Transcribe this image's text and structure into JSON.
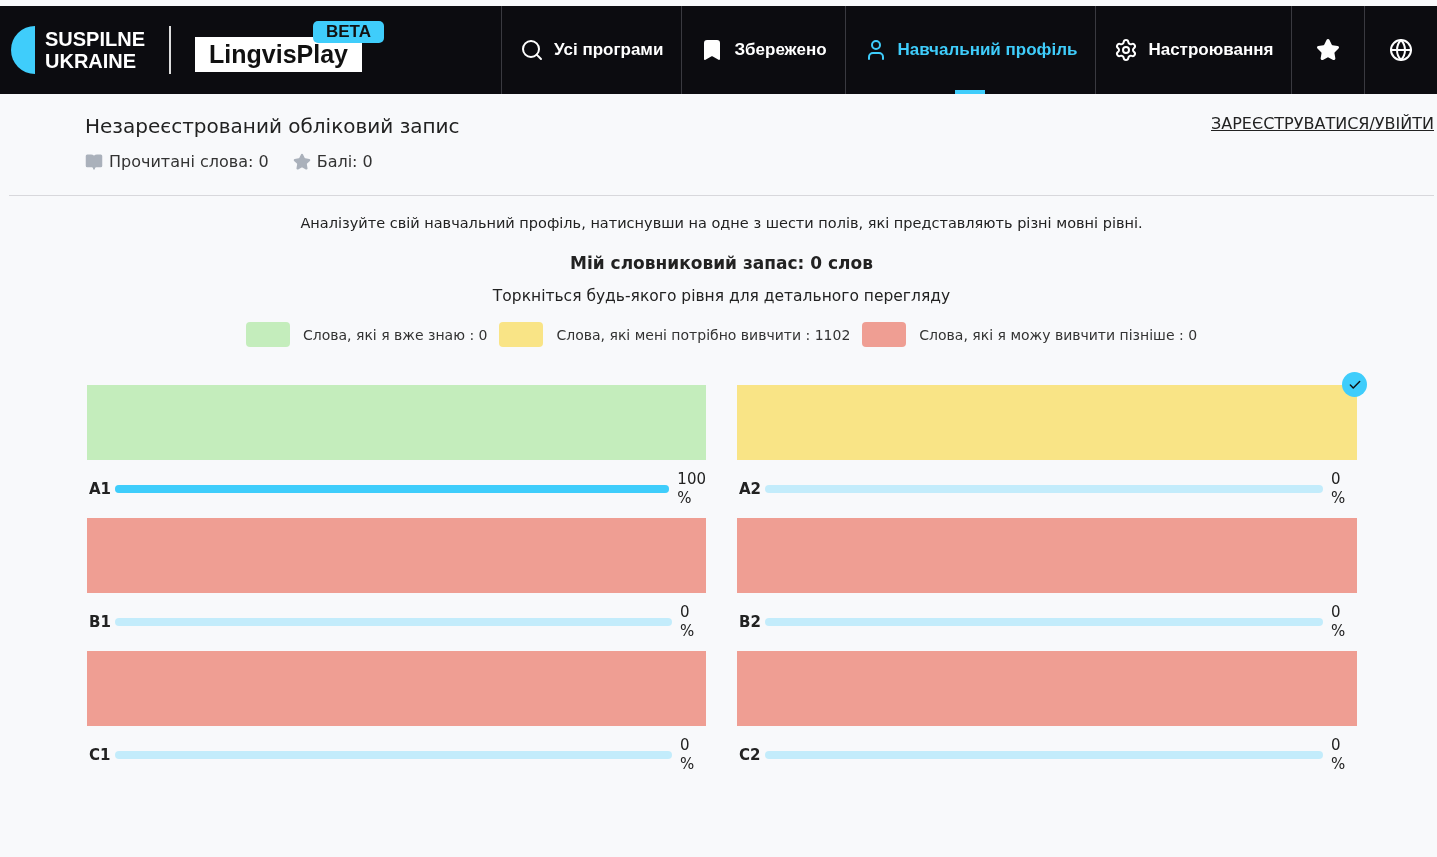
{
  "brand": {
    "name_line1": "SUSPILNE",
    "name_line2": "UKRAINE",
    "product": "LingvisPlay",
    "badge": "BETA"
  },
  "nav": [
    {
      "kind": "search",
      "label": "Усі програми",
      "selected": false
    },
    {
      "kind": "bookmark",
      "label": "Збережено",
      "selected": false
    },
    {
      "kind": "user",
      "label": "Навчальний профіль",
      "selected": true
    },
    {
      "kind": "gear",
      "label": "Настроювання",
      "selected": false
    },
    {
      "kind": "star",
      "selected": false
    },
    {
      "kind": "globe",
      "selected": false
    }
  ],
  "account": {
    "title": "Незареєстрований обліковий запис",
    "read_words": "Прочитані слова: 0",
    "points": "Балі: 0",
    "login_link": "ЗАРЕЄСТРУВАТИСЯ/УВІЙТИ"
  },
  "intro": "Аналізуйте свій навчальний профіль, натиснувши на одне з шести полів, які представляють різні мовні рівні.",
  "vocabulary": "Мій словниковий запас: 0 слов",
  "hint": "Торкніться будь-якого рівня для детального перегляду",
  "legend": [
    {
      "label": "Слова, які я вже знаю : 0",
      "color": "#c4edbc"
    },
    {
      "label": "Слова, які мені потрібно вивчити : 1102",
      "color": "#f9e486"
    },
    {
      "label": "Слова, які я можу вивчити пізніше : 0",
      "color": "#ef9e93"
    }
  ],
  "levels": [
    {
      "name": "A1",
      "color": "#c4edbc",
      "level": 1,
      "reading": "100 %",
      "selected": false
    },
    {
      "name": "A2",
      "color": "#f9e486",
      "level": 0,
      "reading": "0 %",
      "selected": true
    },
    {
      "name": "B1",
      "color": "#ef9e93",
      "level": 0,
      "reading": "0 %",
      "selected": false
    },
    {
      "name": "B2",
      "color": "#ef9e93",
      "level": 0,
      "reading": "0 %",
      "selected": false
    },
    {
      "name": "C1",
      "color": "#ef9e93",
      "level": 0,
      "reading": "0 %",
      "selected": false
    },
    {
      "name": "C2",
      "color": "#ef9e93",
      "level": 0,
      "reading": "0 %",
      "selected": false
    }
  ]
}
